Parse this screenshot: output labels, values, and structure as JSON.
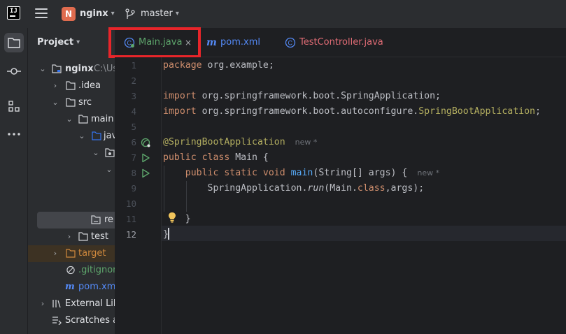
{
  "titlebar": {
    "project_initial": "N",
    "project_name": "nginx",
    "branch": "master"
  },
  "project_panel": {
    "title": "Project",
    "tree": [
      {
        "label": "nginx",
        "suffix": "C:\\Us"
      },
      {
        "label": ".idea"
      },
      {
        "label": "src"
      },
      {
        "label": "main"
      },
      {
        "label": "jav"
      },
      {
        "label": "re"
      },
      {
        "label": "test"
      },
      {
        "label": "target"
      },
      {
        "label": ".gitignor"
      },
      {
        "label": "pom.xml"
      },
      {
        "label": "External Libr"
      },
      {
        "label": "Scratches ar"
      }
    ]
  },
  "tabs": [
    {
      "label": "Main.java",
      "close": "×"
    },
    {
      "label": "pom.xml"
    },
    {
      "label": "TestController.java"
    }
  ],
  "editor": {
    "line_numbers": [
      "1",
      "2",
      "3",
      "4",
      "5",
      "6",
      "7",
      "8",
      "9",
      "10",
      "11",
      "12"
    ],
    "code": {
      "l1_kw": "package",
      "l1_rest": " org.example;",
      "l3_kw": "import",
      "l3_rest": " org.springframework.boot.SpringApplication;",
      "l4_kw": "import",
      "l4_rest": " org.springframework.boot.autoconfigure.",
      "l4_ann": "SpringBootApplication",
      "l4_end": ";",
      "l6_ann": "@SpringBootApplication",
      "l6_hint": "new *",
      "l7_kw": "public class",
      "l7_rest": " Main {",
      "l8_kw": "    public static void",
      "l8_fn": " main",
      "l8_rest": "(String[] args) {",
      "l8_hint": "new *",
      "l9_a": "        SpringApplication.",
      "l9_it": "run",
      "l9_b": "(Main.",
      "l9_kw": "class",
      "l9_c": ",args);",
      "l11": "    }",
      "l12": "}"
    }
  },
  "colors": {
    "accent": "#3574f0",
    "highlight_box": "#e8252a",
    "keyword": "#cf8e6d",
    "annotation": "#b3ae60",
    "method": "#56a8f5"
  }
}
